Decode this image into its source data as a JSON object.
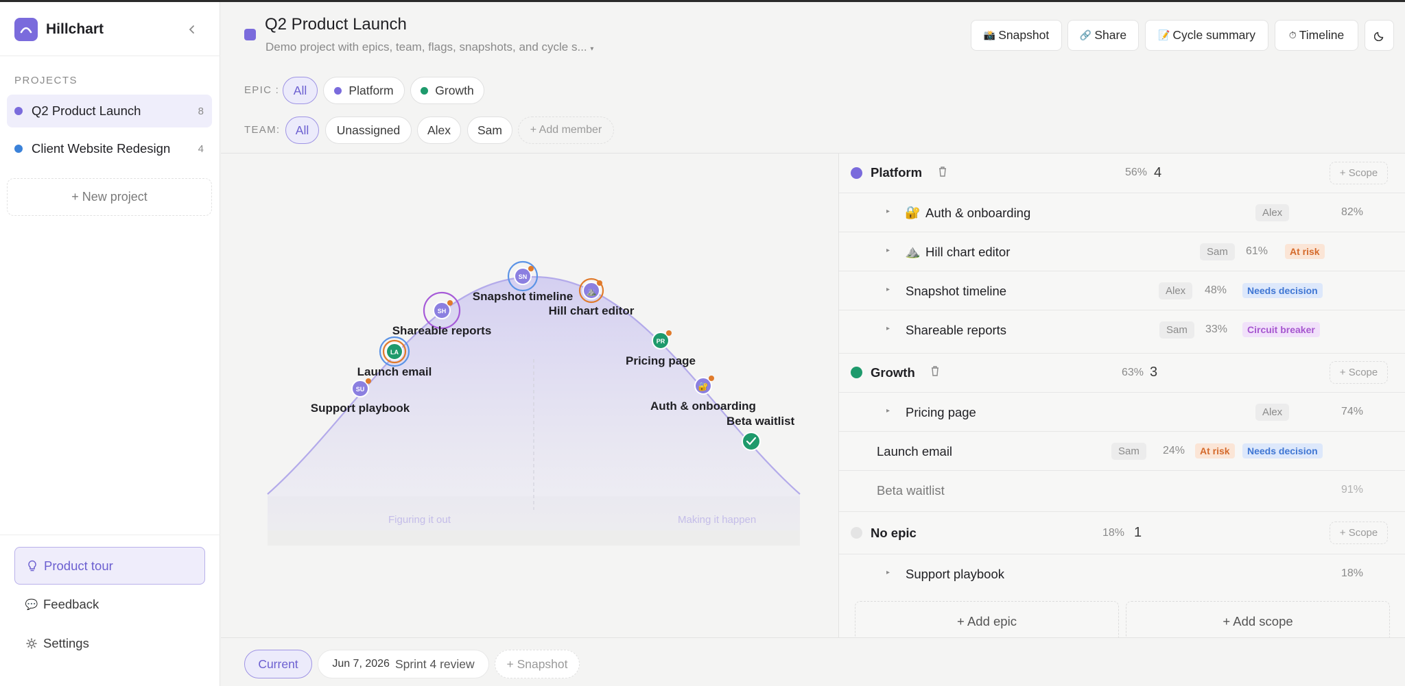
{
  "app": {
    "name": "Hillchart",
    "accent": "#7a6bdc"
  },
  "sidebar": {
    "projects_label": "PROJECTS",
    "projects": [
      {
        "name": "Q2 Product Launch",
        "count": "8",
        "color": "#7a6bdc",
        "active": true
      },
      {
        "name": "Client Website Redesign",
        "count": "4",
        "color": "#3b82d9",
        "active": false
      }
    ],
    "new_project": "+ New project",
    "product_tour": "Product tour",
    "feedback": "Feedback",
    "settings": "Settings"
  },
  "header": {
    "title": "Q2 Product Launch",
    "subtitle": "Demo project with epics, team, flags, snapshots, and cycle s...",
    "buttons": {
      "snapshot": "Snapshot",
      "share": "Share",
      "cycle_summary": "Cycle summary",
      "timeline": "Timeline"
    }
  },
  "filters": {
    "epic_label": "EPIC :",
    "epics": [
      {
        "label": "All",
        "active": true
      },
      {
        "label": "Platform",
        "color": "#7a6bdc"
      },
      {
        "label": "Growth",
        "color": "#1e9a6c"
      }
    ],
    "team_label": "TEAM:",
    "team": [
      {
        "label": "All",
        "active": true
      },
      {
        "label": "Unassigned"
      },
      {
        "label": "Alex"
      },
      {
        "label": "Sam"
      }
    ],
    "add_member": "+ Add member"
  },
  "hill": {
    "left_label": "Figuring it out",
    "right_label": "Making it happen",
    "scopes": [
      {
        "name": "Snapshot timeline",
        "initials": "SN",
        "progress": 48,
        "epic": "Platform"
      },
      {
        "name": "Hill chart editor",
        "initials": "",
        "progress": 61,
        "epic": "Platform"
      },
      {
        "name": "Shareable reports",
        "initials": "SH",
        "progress": 33,
        "epic": "Platform"
      },
      {
        "name": "Launch email",
        "initials": "LA",
        "progress": 24,
        "epic": "Growth"
      },
      {
        "name": "Support playbook",
        "initials": "SU",
        "progress": 18,
        "epic": "No epic"
      },
      {
        "name": "Pricing page",
        "initials": "PR",
        "progress": 74,
        "epic": "Growth"
      },
      {
        "name": "Auth & onboarding",
        "initials": "",
        "progress": 82,
        "epic": "Platform"
      },
      {
        "name": "Beta waitlist",
        "initials": "",
        "progress": 91,
        "epic": "Growth"
      }
    ]
  },
  "epics_list": {
    "platform": {
      "name": "Platform",
      "pct": "56%",
      "count": "4",
      "color": "#7a6bdc"
    },
    "growth": {
      "name": "Growth",
      "pct": "63%",
      "count": "3",
      "color": "#1e9a6c"
    },
    "noepic": {
      "name": "No epic",
      "pct": "18%",
      "count": "1",
      "color": "#e4e4e4"
    },
    "scope_btn": "+ Scope",
    "rows": {
      "auth": {
        "emoji": "🔐",
        "name": "Auth & onboarding",
        "assignee": "Alex",
        "pct": "82%"
      },
      "hill": {
        "emoji": "⛰️",
        "name": "Hill chart editor",
        "assignee": "Sam",
        "pct": "61%",
        "flag": "At risk"
      },
      "snapshot": {
        "name": "Snapshot timeline",
        "assignee": "Alex",
        "pct": "48%",
        "flag": "Needs decision"
      },
      "reports": {
        "name": "Shareable reports",
        "assignee": "Sam",
        "pct": "33%",
        "flag": "Circuit breaker"
      },
      "pricing": {
        "name": "Pricing page",
        "assignee": "Alex",
        "pct": "74%"
      },
      "launch": {
        "name": "Launch email",
        "assignee": "Sam",
        "pct": "24%",
        "flag1": "At risk",
        "flag2": "Needs decision"
      },
      "beta": {
        "name": "Beta waitlist",
        "pct": "91%"
      },
      "support": {
        "name": "Support playbook",
        "pct": "18%"
      }
    },
    "add_epic": "+ Add epic",
    "add_scope": "+ Add scope"
  },
  "footer": {
    "current": "Current",
    "snapshot_date": "Jun 7, 2026",
    "snapshot_name": "Sprint 4 review",
    "add_snapshot": "+ Snapshot"
  }
}
